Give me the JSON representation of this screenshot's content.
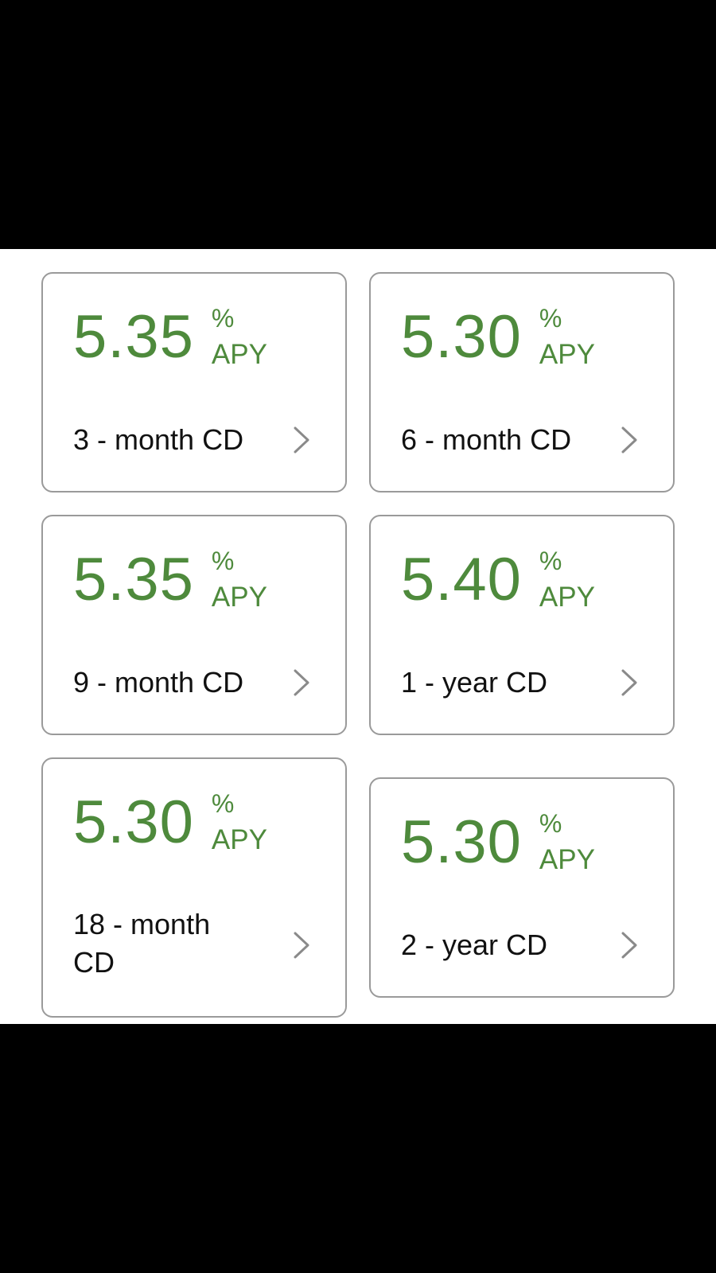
{
  "colors": {
    "rate_green": "#4e8a3c",
    "border_gray": "#9a9a9a",
    "chevron_gray": "#8a8a8a"
  },
  "cards": [
    {
      "rate": "5.35",
      "percent": "%",
      "apy": "APY",
      "term": "3 - month CD"
    },
    {
      "rate": "5.30",
      "percent": "%",
      "apy": "APY",
      "term": "6 - month CD"
    },
    {
      "rate": "5.35",
      "percent": "%",
      "apy": "APY",
      "term": "9 - month CD"
    },
    {
      "rate": "5.40",
      "percent": "%",
      "apy": "APY",
      "term": "1 - year CD"
    },
    {
      "rate": "5.30",
      "percent": "%",
      "apy": "APY",
      "term": "18 - month CD"
    },
    {
      "rate": "5.30",
      "percent": "%",
      "apy": "APY",
      "term": "2 - year CD"
    }
  ],
  "icons": {
    "chevron": "chevron-right-icon"
  }
}
